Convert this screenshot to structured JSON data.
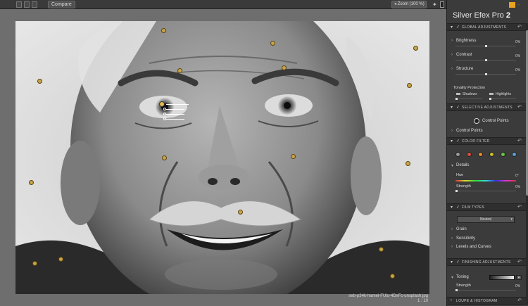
{
  "toolbar": {
    "compare_label": "Compare",
    "zoom_label": "Zoom (100 %)",
    "zoom_chevron": "◂"
  },
  "canvas": {
    "filename": "seb-p34k-hamel-FUlu-4DxFc-unsplash.jpg",
    "zoom_readout": "1 : 10"
  },
  "brand": {
    "name": "Silver Efex Pro",
    "version": "2"
  },
  "panel": {
    "global": {
      "title": "GLOBAL ADJUSTMENTS",
      "rows": [
        {
          "label": "Brightness",
          "value": "0%"
        },
        {
          "label": "Contrast",
          "value": "0%"
        },
        {
          "label": "Structure",
          "value": "0%"
        }
      ],
      "tonality": {
        "label": "Tonality Protection",
        "shadows": "Shadows",
        "highlights": "Highlights"
      }
    },
    "selective": {
      "title": "SELECTIVE ADJUSTMENTS",
      "control_points_button": "Control Points",
      "control_points_row": "Control Points"
    },
    "color_filter": {
      "title": "COLOR FILTER",
      "swatches": [
        "#9a9a9a",
        "#d9513a",
        "#e48a2e",
        "#c9bd35",
        "#6cc246",
        "#5d9ed8"
      ],
      "details_label": "Details",
      "hue_label": "Hue",
      "hue_value": "0°",
      "strength_label": "Strength",
      "strength_value": "0%"
    },
    "film": {
      "title": "FILM TYPES",
      "preset": "Neutral",
      "rows": [
        "Grain",
        "Sensitivity",
        "Levels and Curves"
      ]
    },
    "finishing": {
      "title": "FINISHING ADJUSTMENTS",
      "toning_label": "Toning",
      "strength_label": "Strength",
      "strength_value": "0%"
    },
    "loupe": {
      "title": "LOUPE & HISTOGRAM"
    }
  },
  "icons": {
    "section_chevron": "▾",
    "row_chevron": "›",
    "check": "✓",
    "reset": "↶"
  }
}
